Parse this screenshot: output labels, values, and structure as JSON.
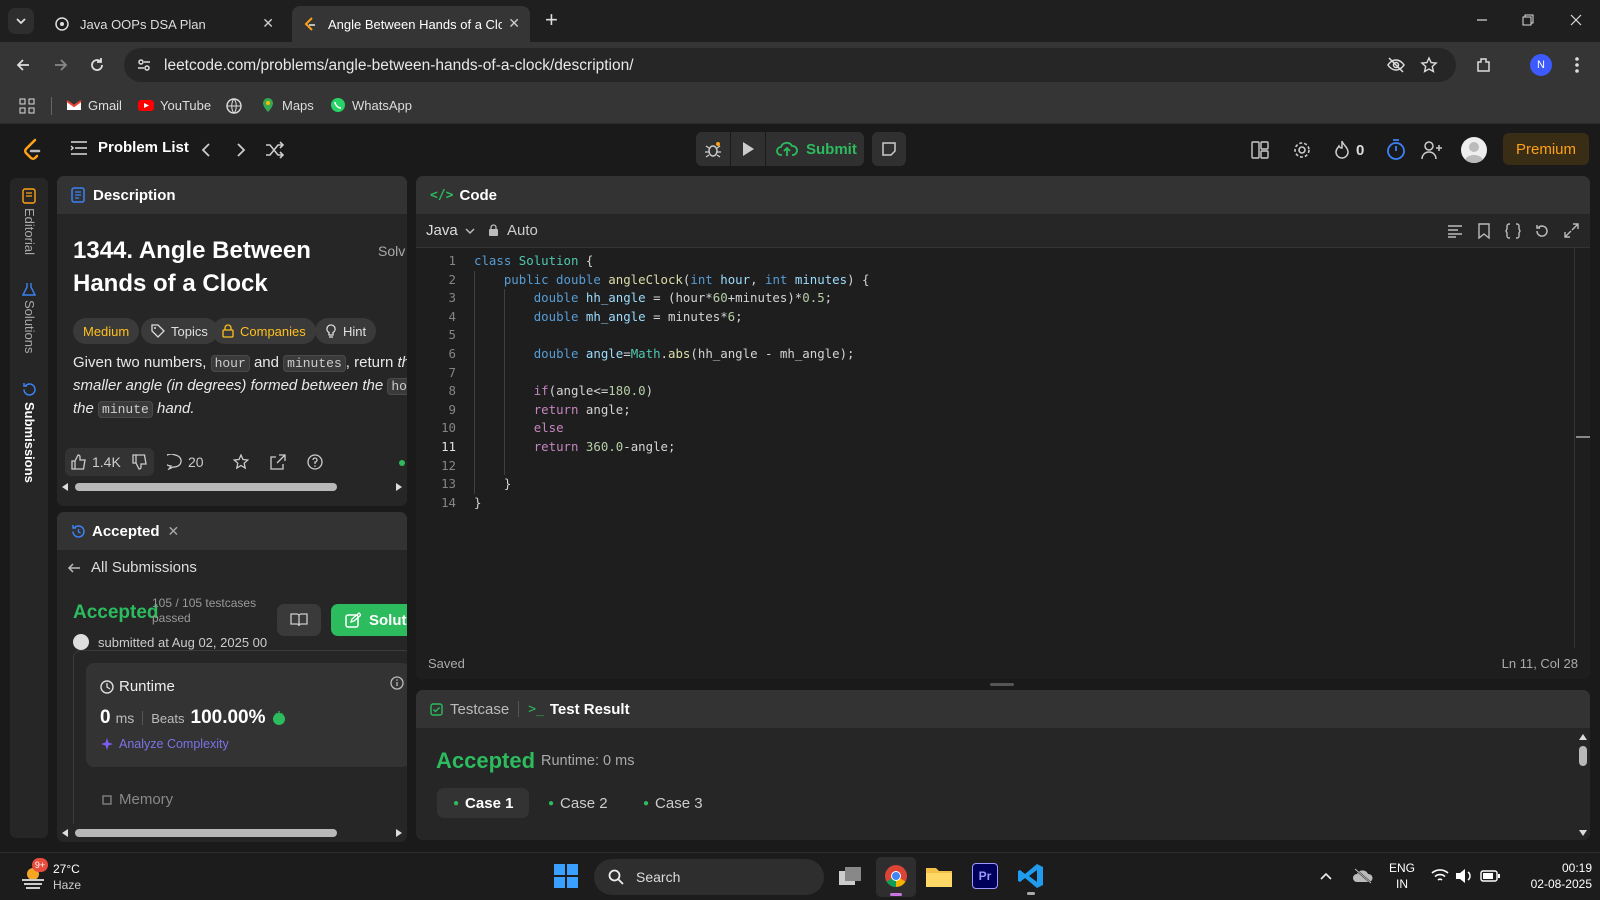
{
  "browser": {
    "tabs": [
      {
        "title": "Java OOPs DSA Plan"
      },
      {
        "title": "Angle Between Hands of a Cloc"
      }
    ],
    "url": "leetcode.com/problems/angle-between-hands-of-a-clock/description/",
    "profile_initial": "N",
    "bookmarks": [
      "Gmail",
      "YouTube",
      "Maps",
      "WhatsApp"
    ]
  },
  "nav": {
    "problem_list": "Problem List",
    "submit": "Submit",
    "streak": "0",
    "premium": "Premium"
  },
  "sidebar": {
    "editorial": "Editorial",
    "solutions": "Solutions",
    "submissions": "Submissions"
  },
  "description": {
    "header": "Description",
    "title_line1": "1344. Angle Between",
    "title_line2": "Hands of a Clock",
    "solved": "Solv",
    "tags": [
      "Medium",
      "Topics",
      "Companies",
      "Hint"
    ],
    "p_given": "Given two numbers, ",
    "p_hour": "hour",
    "p_and": " and ",
    "p_minutes": "minutes",
    "p_return": ", return ",
    "p_the": "the",
    "p_line2": "smaller angle (in degrees) formed between the ",
    "p_hour2": "hour",
    "p_the2": "the ",
    "p_minute": "minute",
    "p_hand": " hand.",
    "likes": "1.4K",
    "comments": "20"
  },
  "submission": {
    "tab": "Accepted",
    "all_submissions": "All Submissions",
    "status": "Accepted",
    "testcases_line1": "105 / 105 testcases",
    "testcases_line2": "passed",
    "submitted": "submitted at Aug 02, 2025 00",
    "solution_btn": "Soluti",
    "runtime_label": "Runtime",
    "runtime_value": "0",
    "runtime_unit": "ms",
    "beats_label": "Beats",
    "beats_value": "100.00%",
    "analyze": "Analyze Complexity",
    "memory_label": "Memory"
  },
  "code": {
    "header": "Code",
    "language": "Java",
    "mode": "Auto",
    "status": "Saved",
    "cursor": "Ln 11, Col 28",
    "line_numbers": [
      "1",
      "2",
      "3",
      "4",
      "5",
      "6",
      "7",
      "8",
      "9",
      "10",
      "11",
      "12",
      "13",
      "14"
    ]
  },
  "result": {
    "testcase_tab": "Testcase",
    "result_tab": "Test Result",
    "status": "Accepted",
    "runtime": "Runtime: 0 ms",
    "cases": [
      "Case 1",
      "Case 2",
      "Case 3"
    ]
  },
  "taskbar": {
    "temp": "27°C",
    "weather": "Haze",
    "badge": "9+",
    "search": "Search",
    "lang1": "ENG",
    "lang2": "IN",
    "time": "00:19",
    "date": "02-08-2025"
  },
  "colors": {
    "accepted": "#2cbb5d",
    "medium": "#ffc01e",
    "premium": "#ffa116"
  }
}
